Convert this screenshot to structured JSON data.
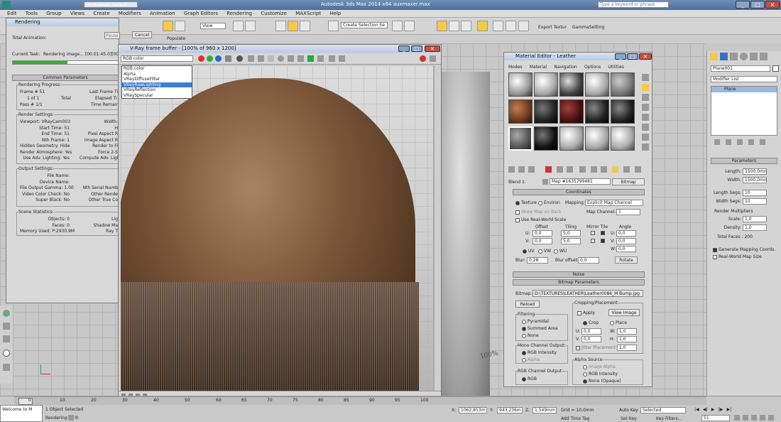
{
  "app": {
    "title": "Autodesk 3ds Max 2014 x64    auxmaxer.max",
    "workspace": "Workspace: Default",
    "search_placeholder": "Type a keyword or phrase"
  },
  "menu": [
    "Edit",
    "Tools",
    "Group",
    "Views",
    "Create",
    "Modifiers",
    "Animation",
    "Graph Editors",
    "Rendering",
    "Customize",
    "MAXScript",
    "Help"
  ],
  "toolbar": {
    "view_dropdown": "View",
    "selection_set": "Create Selection Se",
    "export_label": "Export Textur",
    "gamma_label": "GammaSetting",
    "populate": "Populate"
  },
  "rendering": {
    "title": "Rendering",
    "total_animation": "Total Animation:",
    "current_task_label": "Current Task:",
    "current_task": "Rendering image... [00:01:45.0][00:",
    "pause": "Pause",
    "cancel": "Cancel",
    "common_params": "Common Parameters",
    "progress_group": "Rendering Progress:",
    "frame": "Frame #  51",
    "of": "1 of  1",
    "total": "Total",
    "pass": "Pass #  1/1",
    "last_frame": "Last Frame Ti",
    "elapsed": "Elapsed Ti",
    "time_remain": "Time Remain",
    "settings_group": "Render Settings:",
    "settings": [
      [
        "Viewport:",
        "VRayCam003"
      ],
      [
        "Start Time:",
        "51"
      ],
      [
        "End Time:",
        "51"
      ],
      [
        "Nth Frame:",
        "1"
      ],
      [
        "Hidden Geometry:",
        "Hide"
      ],
      [
        "Render Atmosphere:",
        "Yes"
      ],
      [
        "Use Adv. Lighting:",
        "Yes"
      ]
    ],
    "settings_right": [
      "Width:",
      "H",
      "Pixel Aspect R",
      "Image Aspect R",
      "Render to Fi",
      "Force 2-S",
      "Compute Adv. Ligh"
    ],
    "output_group": "Output Settings:",
    "output": [
      [
        "File Name:",
        ""
      ],
      [
        "Device Name:",
        ""
      ],
      [
        "File Output Gamma:",
        "1.00"
      ],
      [
        "Video Color Check:",
        "No"
      ],
      [
        "Super Black:",
        "No"
      ]
    ],
    "output_right": [
      "Nth Serial Numb",
      "Other Rende",
      "Other True Co"
    ],
    "scene_group": "Scene Statistics:",
    "scene": [
      [
        "Objects:",
        "0"
      ],
      [
        "Faces:",
        "0"
      ],
      [
        "Memory Used:",
        "P:2930.9M"
      ]
    ],
    "scene_right": [
      "Lig",
      "Shadow Ma",
      "Ray T"
    ]
  },
  "vfb": {
    "title": "V-Ray frame buffer - [100% of 960 x 1200]",
    "channel": "RGB color",
    "options": [
      "RGB color",
      "Alpha",
      "VRayDiffuseFilter",
      "VRayRawLighting",
      "VRayReflection",
      "VRaySpecular"
    ],
    "selected_index": 3
  },
  "material": {
    "title": "Material Editor - Leather",
    "menu": [
      "Modes",
      "Material",
      "Navigation",
      "Options",
      "Utilities"
    ],
    "name_label": "Blend 1:",
    "map_name": "Map #1635799481",
    "map_type": "Bitmap",
    "coordinates": "Coordinates",
    "texture": "Texture",
    "environ": "Environ",
    "mapping_label": "Mapping:",
    "mapping": "Explicit Map Channel",
    "show_map_back": "Show Map on Back",
    "map_channel_label": "Map Channel:",
    "map_channel": "1",
    "real_world": "Use Real-World Scale",
    "offset": "Offset",
    "tiling": "Tiling",
    "mirror_tile": "Mirror Tile",
    "angle": "Angle",
    "u_offset": "0,0",
    "v_offset": "0,0",
    "u_tiling": "5,0",
    "v_tiling": "5,0",
    "u_angle": "0,0",
    "v_angle": "0,0",
    "w_angle": "0,0",
    "uv": "UV",
    "vw": "VW",
    "wu": "WU",
    "blur_label": "Blur:",
    "blur": "0,28",
    "blur_offset_label": "Blur offset:",
    "blur_offset": "0,0",
    "rotate": "Rotate",
    "noise": "Noise",
    "bitmap_params": "Bitmap Parameters",
    "bitmap_label": "Bitmap:",
    "bitmap_path": "D:\\TEXTURES\\LEATHER\\Leather0086_M Bump.jpg",
    "reload": "Reload",
    "cropping": "Cropping/Placement",
    "apply": "Apply",
    "view_image": "View Image",
    "crop": "Crop",
    "place": "Place",
    "u_crop": "0,0",
    "w_crop": "1,0",
    "v_crop": "0,0",
    "h_crop": "1,0",
    "jitter": "Jitter Placement:",
    "jitter_val": "1,0",
    "filtering": "Filtering",
    "pyramidal": "Pyramidal",
    "summed": "Summed Area",
    "none": "None",
    "mono_output": "Mono Channel Output:",
    "rgb_intensity": "RGB Intensity",
    "alpha": "Alpha",
    "rgb_output": "RGB Channel Output:",
    "rgb": "RGB",
    "alpha_source": "Alpha Source",
    "image_alpha": "Image Alpha",
    "rgb_intensity2": "RGB Intensity",
    "none_opaque": "None (Opaque)"
  },
  "command_panel": {
    "object_name": "Plane001",
    "modifier_list": "Modifier List",
    "stack_item": "Plane",
    "parameters": "Parameters",
    "length_label": "Length:",
    "length": "1500,0mm",
    "width_label": "Width:",
    "width": "1500,0mm",
    "length_segs_label": "Length Segs:",
    "length_segs": "10",
    "width_segs_label": "Width Segs:",
    "width_segs": "10",
    "render_mult": "Render Multipliers",
    "scale_label": "Scale:",
    "scale": "1,0",
    "density_label": "Density:",
    "density": "1,0",
    "total_faces": "Total Faces : 200",
    "gen_mapping": "Generate Mapping Coords.",
    "real_world_map": "Real-World Map Size"
  },
  "viewport": {
    "label_100": "100%"
  },
  "status": {
    "selected": "1 Object Selected",
    "welcome": "Welcome to M",
    "rendering": "Rendering",
    "x_label": "X:",
    "x": "1062,853m",
    "y_label": "Y:",
    "y": "943,236m",
    "z_label": "Z:",
    "z": "1,549mm",
    "grid": "Grid = 10,0mm",
    "auto_key": "Auto Key",
    "auto_key_value": "Selected",
    "set_key": "Set Key",
    "key_filters": "Key Filters...",
    "add_time_tag": "Add Time Tag",
    "frame": "51",
    "timeline_ticks": [
      "0",
      "10",
      "20",
      "30",
      "40",
      "50",
      "60",
      "65",
      "70",
      "75",
      "80",
      "85",
      "90",
      "95",
      "100"
    ]
  }
}
